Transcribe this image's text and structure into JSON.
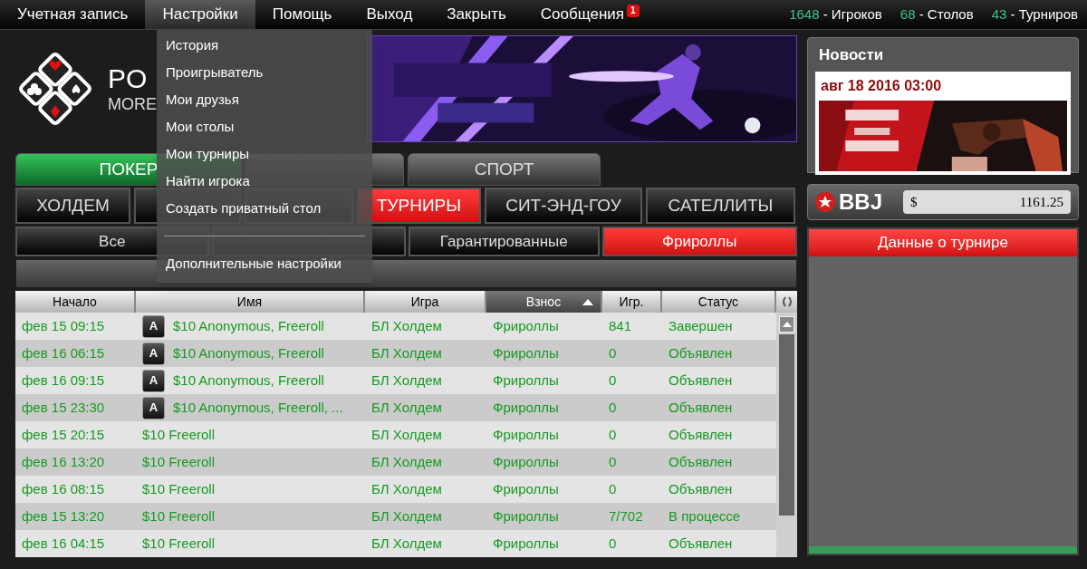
{
  "menu_bar": [
    {
      "label": "Учетная запись",
      "selected": false
    },
    {
      "label": "Настройки",
      "selected": true
    },
    {
      "label": "Помощь",
      "selected": false
    },
    {
      "label": "Выход",
      "selected": false
    },
    {
      "label": "Закрыть",
      "selected": false
    },
    {
      "label": "Сообщения",
      "selected": false,
      "badge": "1"
    }
  ],
  "stats": [
    {
      "count": "1648",
      "caption": "- Игроков"
    },
    {
      "count": "68",
      "caption": "- Столов"
    },
    {
      "count": "43",
      "caption": "- Турниров"
    }
  ],
  "logo": {
    "title": "PO",
    "subtitle": "MORE"
  },
  "settings_menu": {
    "items": [
      {
        "label": "История",
        "kind": "item"
      },
      {
        "label": "Проигрыватель",
        "kind": "item"
      },
      {
        "label": "Мои друзья",
        "kind": "item"
      },
      {
        "label": "Мои столы",
        "kind": "item"
      },
      {
        "label": "Мои турниры",
        "kind": "item"
      },
      {
        "label": "Найти игрока",
        "kind": "item"
      },
      {
        "label": "Создать приватный стол",
        "kind": "item"
      },
      {
        "kind": "separator"
      },
      {
        "label": "Дополнительные настройки",
        "kind": "item"
      }
    ]
  },
  "category_tabs": [
    {
      "label": "ПОКЕР",
      "selected": true
    },
    {
      "selected": false
    },
    {
      "label": "СПОРТ",
      "selected": false
    }
  ],
  "game_tabs": [
    {
      "label": "ХОЛДЕМ",
      "selected": false
    },
    {
      "selected": false
    },
    {
      "selected": false
    },
    {
      "label": "ТУРНИРЫ",
      "selected": true
    },
    {
      "label": "СИТ-ЭНД-ГОУ",
      "selected": false
    },
    {
      "label": "САТЕЛЛИТЫ",
      "selected": false
    }
  ],
  "filter_tabs": [
    {
      "label": "Все",
      "selected": false
    },
    {
      "selected": false
    },
    {
      "label": "Гарантированные",
      "selected": false
    },
    {
      "label": "Фрироллы",
      "selected": true
    }
  ],
  "table": {
    "columns": [
      {
        "label": "Начало",
        "sorted": false
      },
      {
        "label": "Имя",
        "sorted": false
      },
      {
        "label": "Игра",
        "sorted": false
      },
      {
        "label": "Взнос",
        "sorted": true
      },
      {
        "label": "Игр.",
        "sorted": false
      },
      {
        "label": "Статус",
        "sorted": false
      }
    ],
    "rows": [
      {
        "start": "фев 15 09:15",
        "badge": "A",
        "name": "$10 Anonymous, Freeroll",
        "game": "БЛ Холдем",
        "buyin": "Фрироллы",
        "players": "841",
        "status": "Завершен"
      },
      {
        "start": "фев 16 06:15",
        "badge": "A",
        "name": "$10 Anonymous, Freeroll",
        "game": "БЛ Холдем",
        "buyin": "Фрироллы",
        "players": "0",
        "status": "Объявлен"
      },
      {
        "start": "фев 16 09:15",
        "badge": "A",
        "name": "$10 Anonymous, Freeroll",
        "game": "БЛ Холдем",
        "buyin": "Фрироллы",
        "players": "0",
        "status": "Объявлен"
      },
      {
        "start": "фев 15 23:30",
        "badge": "A",
        "name": "$10 Anonymous, Freeroll, ...",
        "game": "БЛ Холдем",
        "buyin": "Фрироллы",
        "players": "0",
        "status": "Объявлен"
      },
      {
        "start": "фев 15 20:15",
        "name": "$10 Freeroll",
        "game": "БЛ Холдем",
        "buyin": "Фрироллы",
        "players": "0",
        "status": "Объявлен"
      },
      {
        "start": "фев 16 13:20",
        "name": "$10 Freeroll",
        "game": "БЛ Холдем",
        "buyin": "Фрироллы",
        "players": "0",
        "status": "Объявлен"
      },
      {
        "start": "фев 16 08:15",
        "name": "$10 Freeroll",
        "game": "БЛ Холдем",
        "buyin": "Фрироллы",
        "players": "0",
        "status": "Объявлен"
      },
      {
        "start": "фев 15 13:20",
        "name": "$10 Freeroll",
        "game": "БЛ Холдем",
        "buyin": "Фрироллы",
        "players": "7/702",
        "status": "В процессе"
      },
      {
        "start": "фев 16 04:15",
        "name": "$10 Freeroll",
        "game": "БЛ Холдем",
        "buyin": "Фрироллы",
        "players": "0",
        "status": "Объявлен"
      }
    ]
  },
  "news": {
    "title": "Новости",
    "date": "авг 18 2016 03:00"
  },
  "jackpot": {
    "label": "BBJ",
    "currency": "$",
    "amount": "1161.25"
  },
  "tournament_panel": {
    "title": "Данные о турнире"
  }
}
